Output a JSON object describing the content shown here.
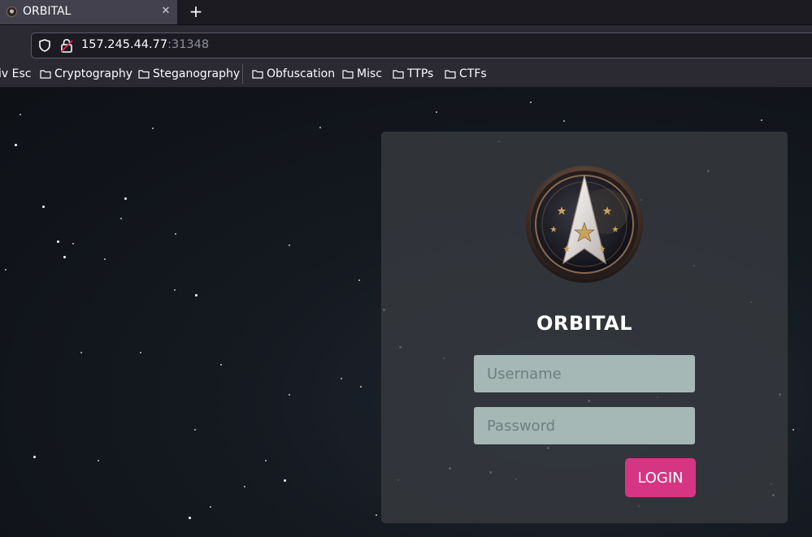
{
  "tab": {
    "title": "ORBITAL",
    "close_icon": "close-icon",
    "new_tab_label": "+"
  },
  "address_bar": {
    "host": "157.245.44.77",
    "port": ":31348"
  },
  "bookmarks": [
    {
      "label": "iv Esc",
      "icon": ""
    },
    {
      "label": "Cryptography",
      "icon": "folder-icon"
    },
    {
      "label": "Steganography",
      "icon": "folder-icon"
    },
    {
      "label": "Obfuscation",
      "icon": "folder-icon"
    },
    {
      "label": "Misc",
      "icon": "folder-icon"
    },
    {
      "label": "TTPs",
      "icon": "folder-icon"
    },
    {
      "label": "CTFs",
      "icon": "folder-icon"
    }
  ],
  "login": {
    "title": "ORBITAL",
    "username_placeholder": "Username",
    "username_value": "",
    "password_placeholder": "Password",
    "password_value": "",
    "button_label": "LOGIN"
  },
  "colors": {
    "accent": "#d63583",
    "input_bg": "#a5b8b5",
    "card_bg": "#373a3f",
    "background": "#0f1217"
  }
}
